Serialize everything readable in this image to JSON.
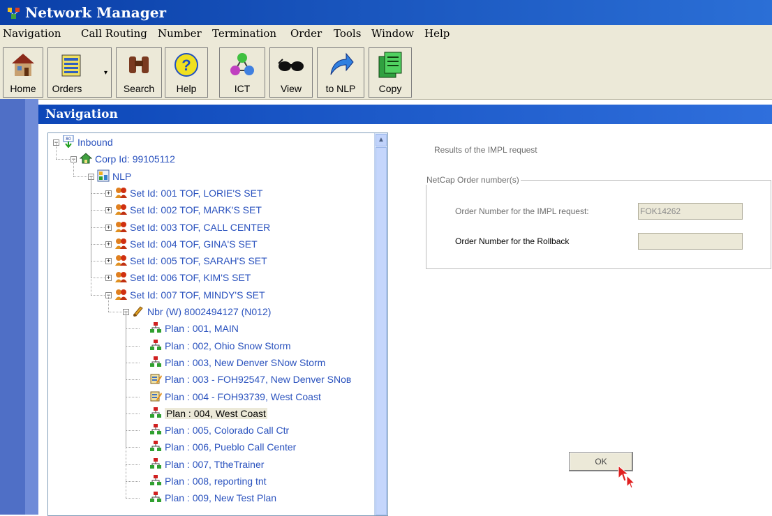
{
  "window": {
    "title": "Network Manager"
  },
  "menu": [
    "Navigation",
    "Call Routing",
    "Number",
    "Termination",
    "Order",
    "Tools",
    "Window",
    "Help"
  ],
  "toolbar": [
    {
      "label": "Home",
      "icon": "house-icon"
    },
    {
      "label": "Orders",
      "icon": "orders-icon"
    },
    {
      "label": "Search",
      "icon": "binoculars-icon"
    },
    {
      "label": "Help",
      "icon": "help-icon"
    },
    {
      "label": "ICT",
      "icon": "network-icon"
    },
    {
      "label": "View",
      "icon": "glasses-icon"
    },
    {
      "label": "to NLP",
      "icon": "arrow-icon"
    },
    {
      "label": "Copy",
      "icon": "copy-icon"
    }
  ],
  "nav": {
    "header": "Navigation"
  },
  "tree": [
    {
      "label": "Inbound",
      "level": 0,
      "icon": "inbound-icon"
    },
    {
      "label": "Corp Id: 99105112",
      "level": 1,
      "icon": "corp-icon"
    },
    {
      "label": "NLP",
      "level": 2,
      "icon": "nlp-icon"
    },
    {
      "label": "Set Id:  001 TOF, LORIE'S SET",
      "level": 3,
      "icon": "set-icon"
    },
    {
      "label": "Set Id:  002 TOF, MARK'S SET",
      "level": 3,
      "icon": "set-icon"
    },
    {
      "label": "Set Id:  003 TOF, CALL CENTER",
      "level": 3,
      "icon": "set-icon"
    },
    {
      "label": "Set Id:  004 TOF, GINA'S SET",
      "level": 3,
      "icon": "set-icon"
    },
    {
      "label": "Set Id:  005 TOF, SARAH'S SET",
      "level": 3,
      "icon": "set-icon"
    },
    {
      "label": "Set Id:  006 TOF, KIM'S SET",
      "level": 3,
      "icon": "set-icon"
    },
    {
      "label": "Set Id:  007 TOF, MINDY'S SET",
      "level": 3,
      "icon": "set-icon"
    },
    {
      "label": "Nbr (W) 8002494127 (N012)",
      "level": 4,
      "icon": "phone-icon"
    },
    {
      "label": "Plan : 001, MAIN",
      "level": 5,
      "icon": "plan-icon"
    },
    {
      "label": "Plan : 002, Ohio Snow Storm",
      "level": 5,
      "icon": "plan-icon"
    },
    {
      "label": "Plan : 003, New Denver SNow Storm",
      "level": 5,
      "icon": "plan-icon"
    },
    {
      "label": "Plan : 003 - FOH92547, New Denver SNoв",
      "level": 5,
      "icon": "plan-edit-icon"
    },
    {
      "label": "Plan : 004 - FOH93739, West Coast",
      "level": 5,
      "icon": "plan-edit-icon"
    },
    {
      "label": "Plan : 004, West Coast",
      "level": 5,
      "icon": "plan-icon",
      "selected": true
    },
    {
      "label": "Plan : 005, Colorado Call Ctr",
      "level": 5,
      "icon": "plan-icon"
    },
    {
      "label": "Plan : 006, Pueblo Call Center",
      "level": 5,
      "icon": "plan-icon"
    },
    {
      "label": "Plan : 007, TtheTrainer",
      "level": 5,
      "icon": "plan-icon"
    },
    {
      "label": "Plan : 008, reporting tnt",
      "level": 5,
      "icon": "plan-icon"
    },
    {
      "label": "Plan : 009, New Test Plan",
      "level": 5,
      "icon": "plan-icon"
    }
  ],
  "results": {
    "heading": "Results of the IMPL request",
    "group_title": "NetCap Order number(s)",
    "impl_label": "Order Number for the IMPL request:",
    "impl_value": "FOK14262",
    "rollback_label": "Order Number for the Rollback",
    "rollback_value": "",
    "ok_label": "OK"
  }
}
